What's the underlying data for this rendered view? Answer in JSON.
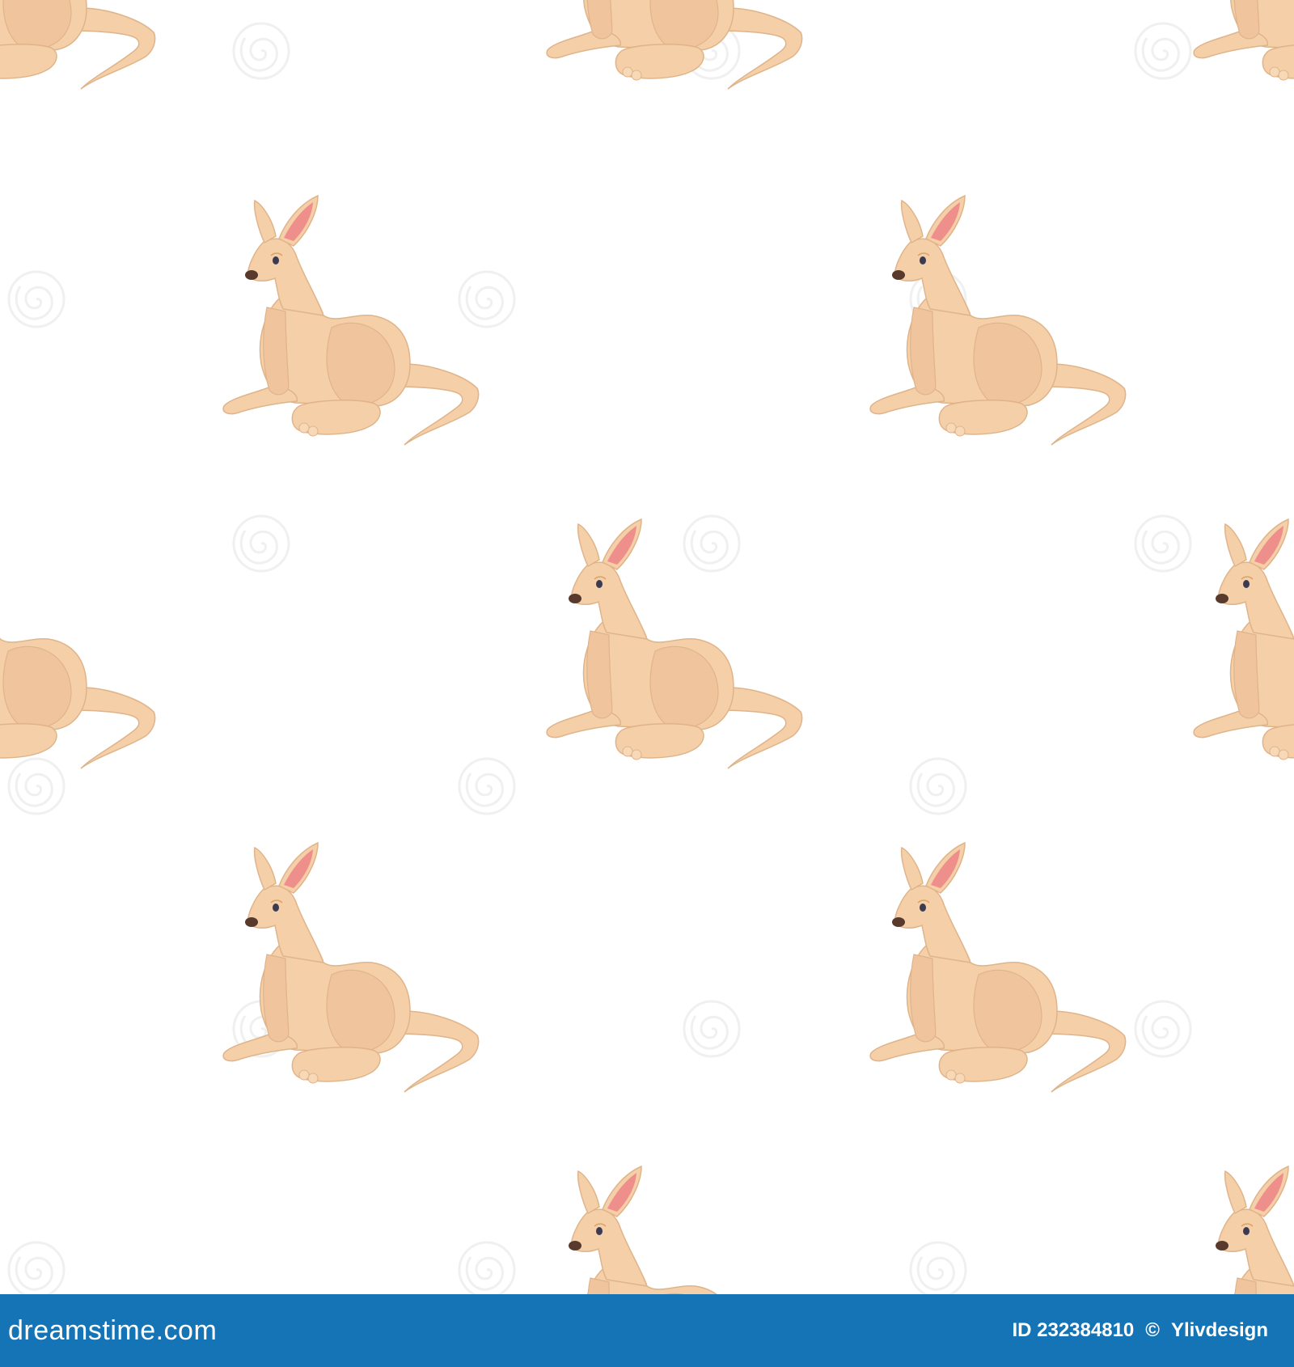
{
  "image": {
    "subject": "seamless pattern of sitting cartoon kangaroos",
    "background_color": "#ffffff",
    "kangaroo_body_color": "#f4cfa8",
    "kangaroo_shade_color": "#e9bb90",
    "kangaroo_ear_color": "#ef8f8c",
    "kangaroo_nose_color": "#5a3a2c"
  },
  "watermark": {
    "icon": "swirl-watermark-icon",
    "text": "dreamstime.com"
  },
  "footer": {
    "brand_text": "dreamstime.com",
    "brand_icon": "swirl-logo-icon",
    "id_text": "ID 232384810",
    "copyright_symbol": "©",
    "author": "Ylivdesign",
    "background_color": "#1474b5"
  }
}
